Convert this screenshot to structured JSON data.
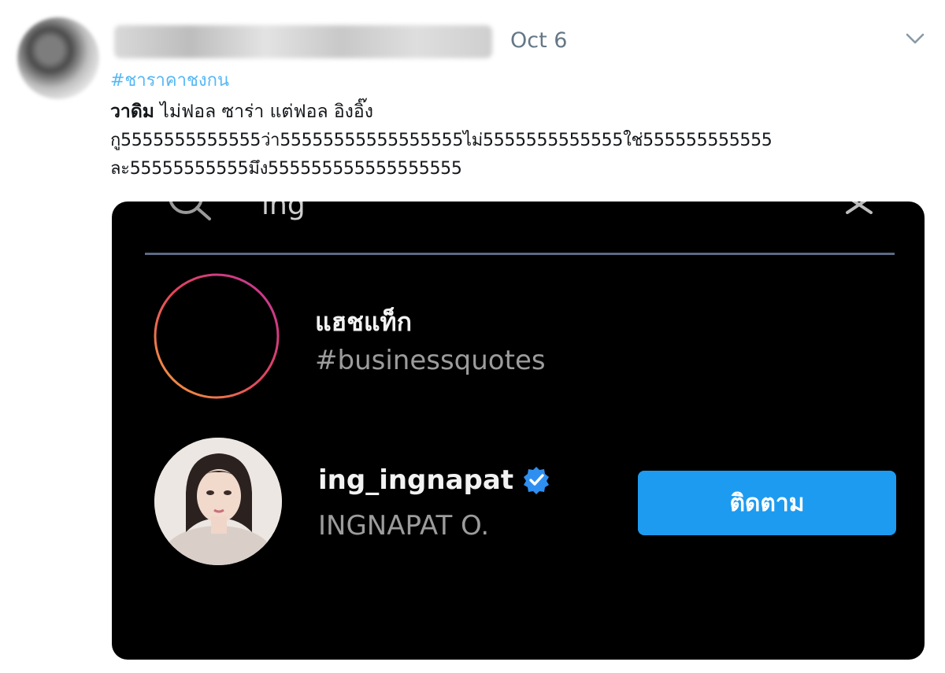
{
  "tweet": {
    "date": "Oct 6",
    "hashtag": "#ชาราคาชงกน",
    "line1_bold": "วาดิม",
    "line1_rest": " ไม่ฟอล ซาร่า แต่ฟอล อิงอิ๊ง",
    "line2": "กู5555555555555ว่า55555555555555555ไม่5555555555555ใช่555555555555",
    "line3": "ละ55555555555มึง555555555555555555"
  },
  "embed": {
    "search_query": "ing",
    "hashtag_result": {
      "type_label": "แฮชแท็ก",
      "name": "#businessquotes"
    },
    "user_result": {
      "username": "ing_ingnapat",
      "full_name": "INGNAPAT O.",
      "follow_label": "ติดตาม"
    }
  },
  "icons": {
    "more": "chevron-down-icon",
    "search": "search-icon",
    "close": "close-icon",
    "hashtag": "hashtag-icon",
    "verified": "verified-badge-icon"
  },
  "colors": {
    "link": "#1da1f2",
    "follow_button": "#1d9bf0",
    "embed_background": "#000000",
    "divider": "#5b6a86"
  }
}
